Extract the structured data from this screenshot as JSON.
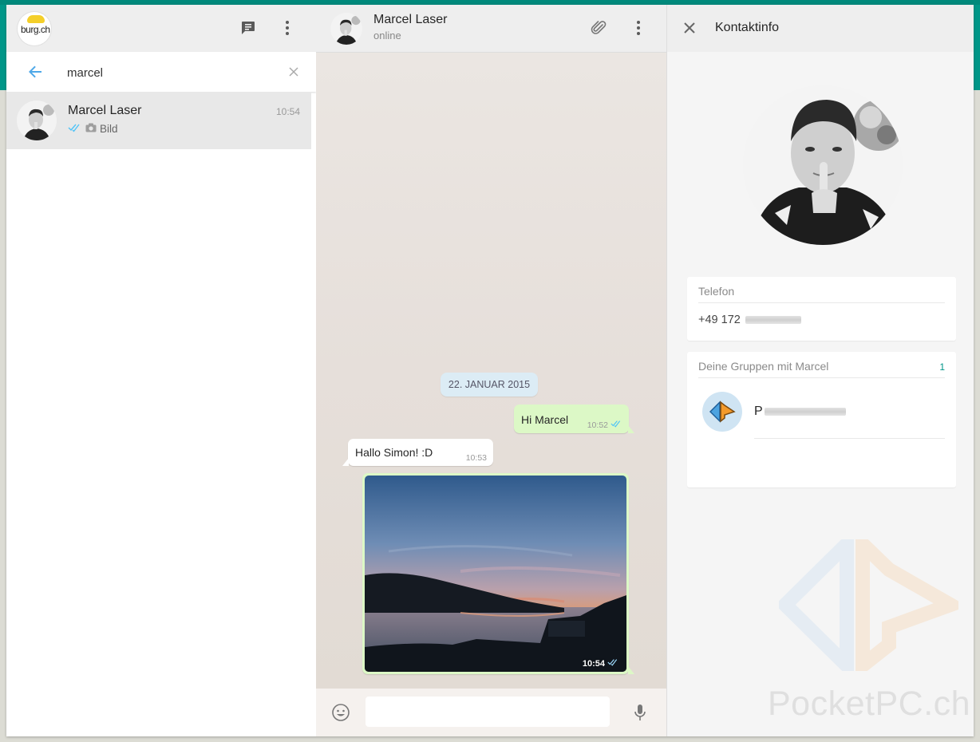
{
  "sidebar": {
    "profile_logo_text": "burg.ch",
    "search": {
      "value": "marcel"
    },
    "chats": [
      {
        "name": "Marcel Laser",
        "time": "10:54",
        "preview": "Bild"
      }
    ]
  },
  "conversation": {
    "contact_name": "Marcel Laser",
    "contact_status": "online",
    "date_chip": "22. JANUAR 2015",
    "messages": [
      {
        "direction": "out",
        "text": "Hi Marcel",
        "time": "10:52"
      },
      {
        "direction": "in",
        "text": "Hallo Simon! :D",
        "time": "10:53"
      },
      {
        "direction": "out",
        "type": "image",
        "time": "10:54"
      }
    ],
    "composer": {
      "value": ""
    }
  },
  "contact_info": {
    "title": "Kontaktinfo",
    "phone_label": "Telefon",
    "phone_value": "+49 172",
    "groups_label": "Deine Gruppen mit Marcel",
    "groups_count": "1",
    "groups": [
      {
        "name_visible": "P"
      }
    ]
  },
  "watermark": {
    "text": "PocketPC.ch"
  },
  "colors": {
    "teal": "#009688",
    "bubble_out": "#dcf8c6",
    "tick_blue": "#4fc3f7"
  }
}
